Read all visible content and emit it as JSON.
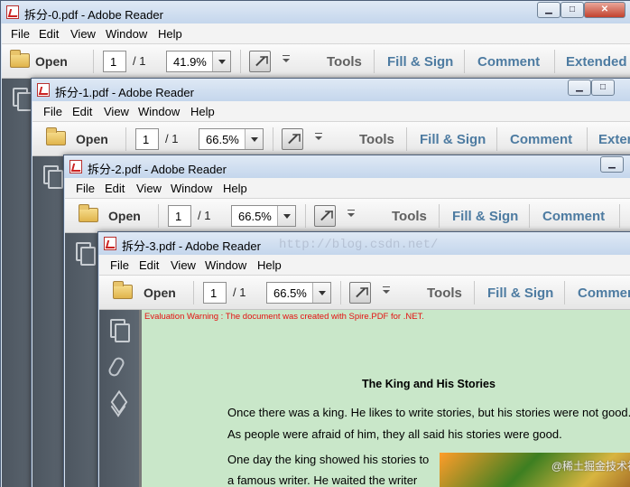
{
  "windows": [
    {
      "title": "拆分-0.pdf - Adobe Reader",
      "zoom": "41.9%"
    },
    {
      "title": "拆分-1.pdf - Adobe Reader",
      "zoom": "66.5%"
    },
    {
      "title": "拆分-2.pdf - Adobe Reader",
      "zoom": "66.5%"
    },
    {
      "title": "拆分-3.pdf - Adobe Reader",
      "zoom": "66.5%"
    }
  ],
  "menu": [
    "File",
    "Edit",
    "View",
    "Window",
    "Help"
  ],
  "toolbar": {
    "open_label": "Open",
    "page_current": "1",
    "page_total": "/ 1",
    "tools_label": "Tools",
    "fill_sign_label": "Fill & Sign",
    "comment_label": "Comment",
    "extended_label": "Extended",
    "extended_clipped_label": "Exter",
    "comment_clipped_label": "Commer"
  },
  "document": {
    "eval_warning": "Evaluation Warning : The document was created with Spire.PDF for .NET.",
    "title": "The King and His Stories",
    "lines": [
      "Once there was a king. He likes to write stories, but his stories were not good.",
      "As people were afraid of him, they all said his stories were good.",
      "One day the king showed his stories to",
      "a famous writer. He waited the writer"
    ]
  },
  "watermarks": {
    "url": "http://blog.csdn.net/",
    "site": "@稀土掘金技术社区"
  },
  "colors": {
    "tab_blue": "#4d7ba1",
    "page_bg": "#c9e7c9",
    "eval_red": "#e41010"
  }
}
